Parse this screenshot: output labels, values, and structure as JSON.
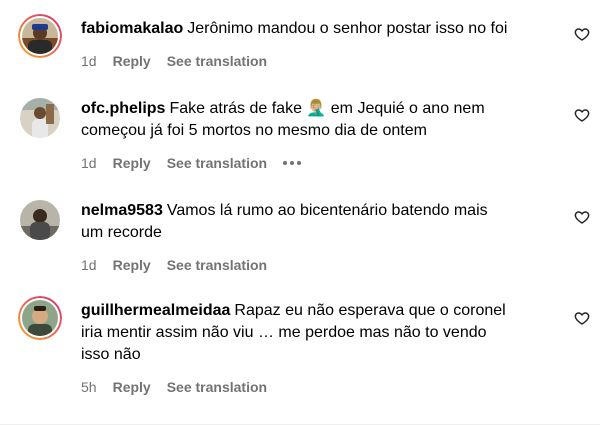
{
  "colors": {
    "text": "#000000",
    "secondary": "#737373",
    "story_ring_start": "#f9a825",
    "story_ring_end": "#d62976"
  },
  "comments": [
    {
      "username": "fabiomakalao",
      "text": "Jerônimo mandou o senhor postar isso no foi",
      "time": "1d",
      "reply_label": "Reply",
      "translate_label": "See translation",
      "has_story_ring": true,
      "has_more": false,
      "icon": "heart-icon"
    },
    {
      "username": "ofc.phelips",
      "text": "Fake atrás de fake 🤦🏼‍♂️ em Jequié o ano nem\ncomeçou já foi 5 mortos no mesmo dia de ontem",
      "time": "1d",
      "reply_label": "Reply",
      "translate_label": "See translation",
      "has_story_ring": false,
      "has_more": true,
      "icon": "heart-icon"
    },
    {
      "username": "nelma9583",
      "text": "Vamos lá rumo ao bicentenário batendo mais\num recorde",
      "time": "1d",
      "reply_label": "Reply",
      "translate_label": "See translation",
      "has_story_ring": false,
      "has_more": false,
      "icon": "heart-icon"
    },
    {
      "username": "guillhermealmeidaa",
      "text": "Rapaz eu não esperava que o coronel\niria mentir assim não viu … me perdoe mas não to vendo\nisso não",
      "time": "5h",
      "reply_label": "Reply",
      "translate_label": "See translation",
      "has_story_ring": true,
      "has_more": false,
      "icon": "heart-icon"
    }
  ]
}
